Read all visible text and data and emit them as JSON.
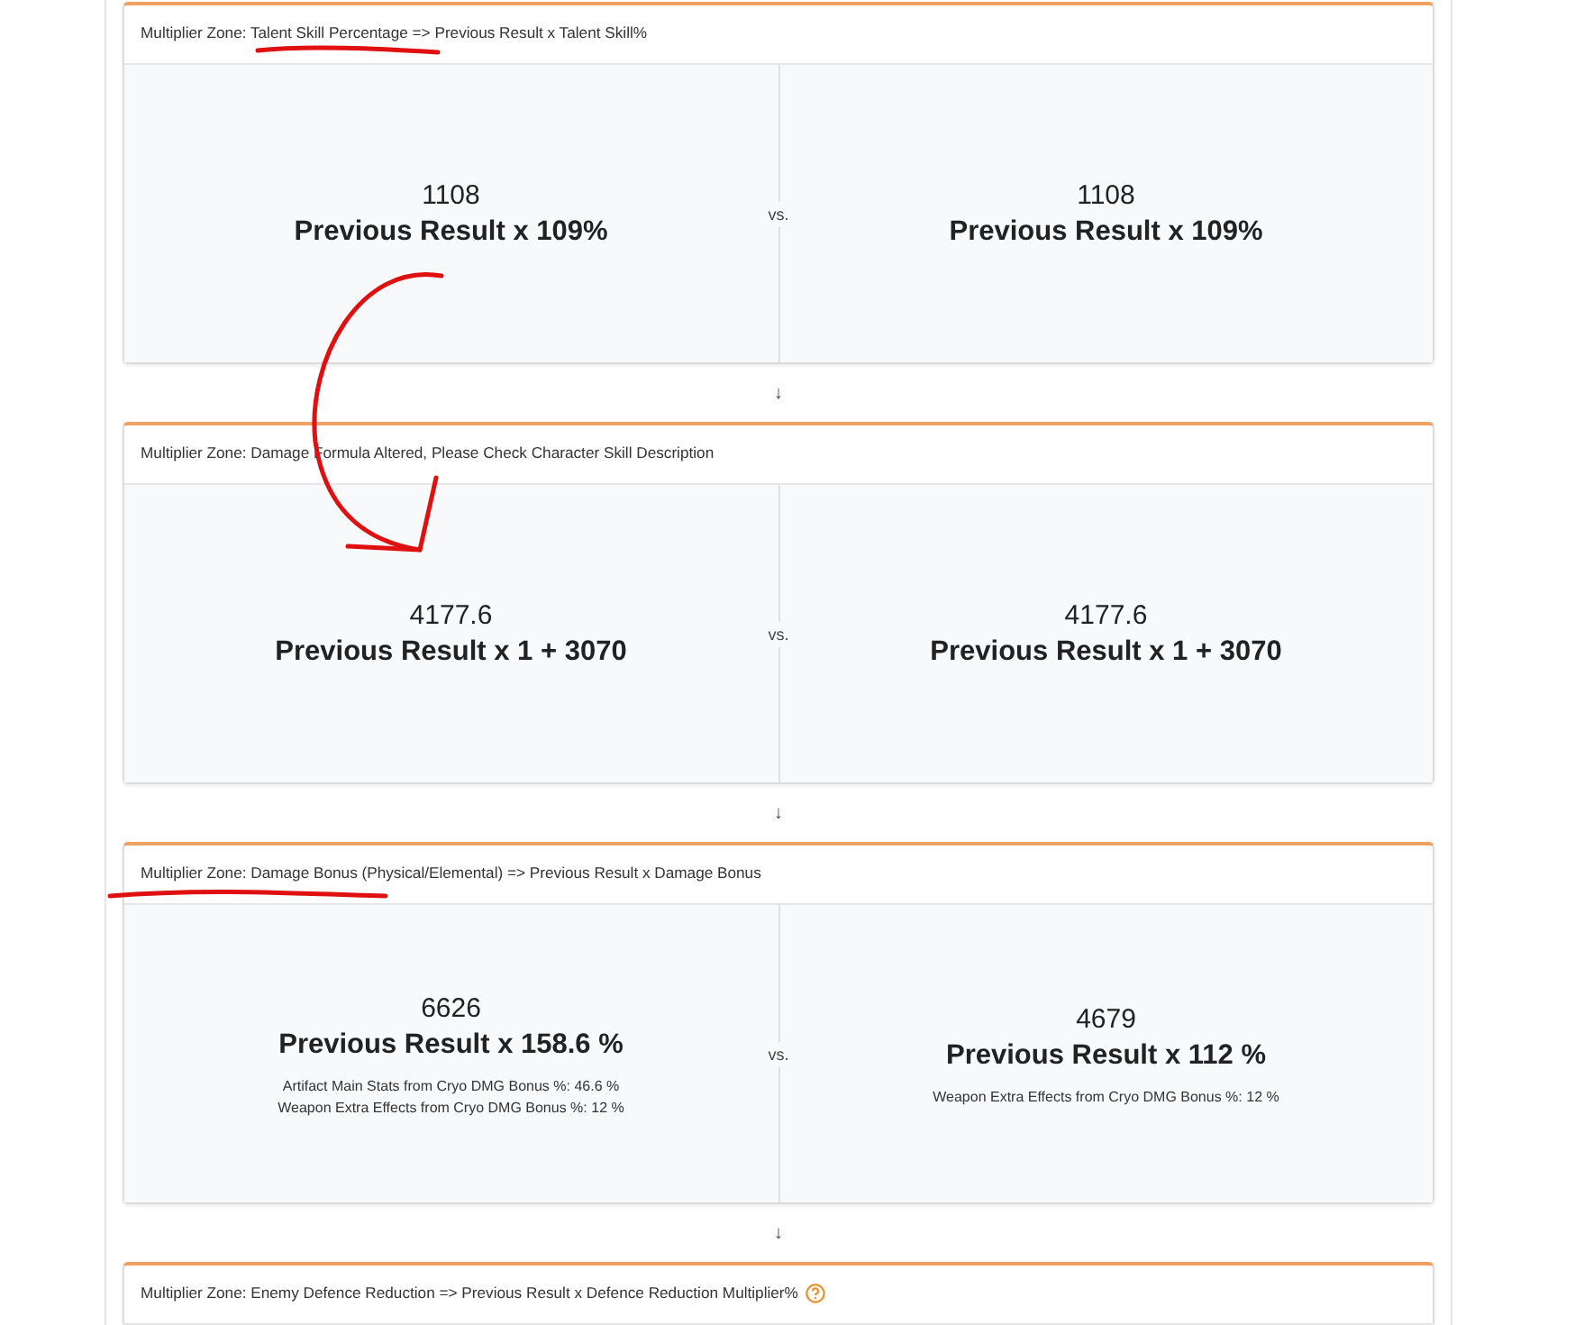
{
  "zones": [
    {
      "title": "Multiplier Zone: Talent Skill Percentage => Previous Result x Talent Skill%",
      "help": false,
      "left": {
        "value": "1108",
        "formula": "Previous Result x 109%"
      },
      "separator": "vs.",
      "right": {
        "value": "1108",
        "formula": "Previous Result x 109%"
      },
      "arrow": "↓"
    },
    {
      "title": "Multiplier Zone: Damage Formula Altered, Please Check Character Skill Description",
      "help": false,
      "left": {
        "value": "4177.6",
        "formula": "Previous Result x 1 + 3070"
      },
      "separator": "vs.",
      "right": {
        "value": "4177.6",
        "formula": "Previous Result x 1 + 3070"
      },
      "arrow": "↓"
    },
    {
      "title": "Multiplier Zone: Damage Bonus (Physical/Elemental) => Previous Result x Damage Bonus",
      "help": false,
      "left": {
        "value": "6626",
        "formula": "Previous Result x 158.6 %",
        "notes": [
          "Artifact Main Stats from Cryo DMG Bonus %: 46.6 %",
          "Weapon Extra Effects from Cryo DMG Bonus %: 12 %"
        ]
      },
      "separator": "vs.",
      "right": {
        "value": "4679",
        "formula": "Previous Result x 112 %",
        "notes": [
          "Weapon Extra Effects from Cryo DMG Bonus %: 12 %"
        ]
      },
      "arrow": "↓"
    },
    {
      "title": "Multiplier Zone: Enemy Defence Reduction => Previous Result x Defence Reduction Multiplier%",
      "help": true
    }
  ]
}
